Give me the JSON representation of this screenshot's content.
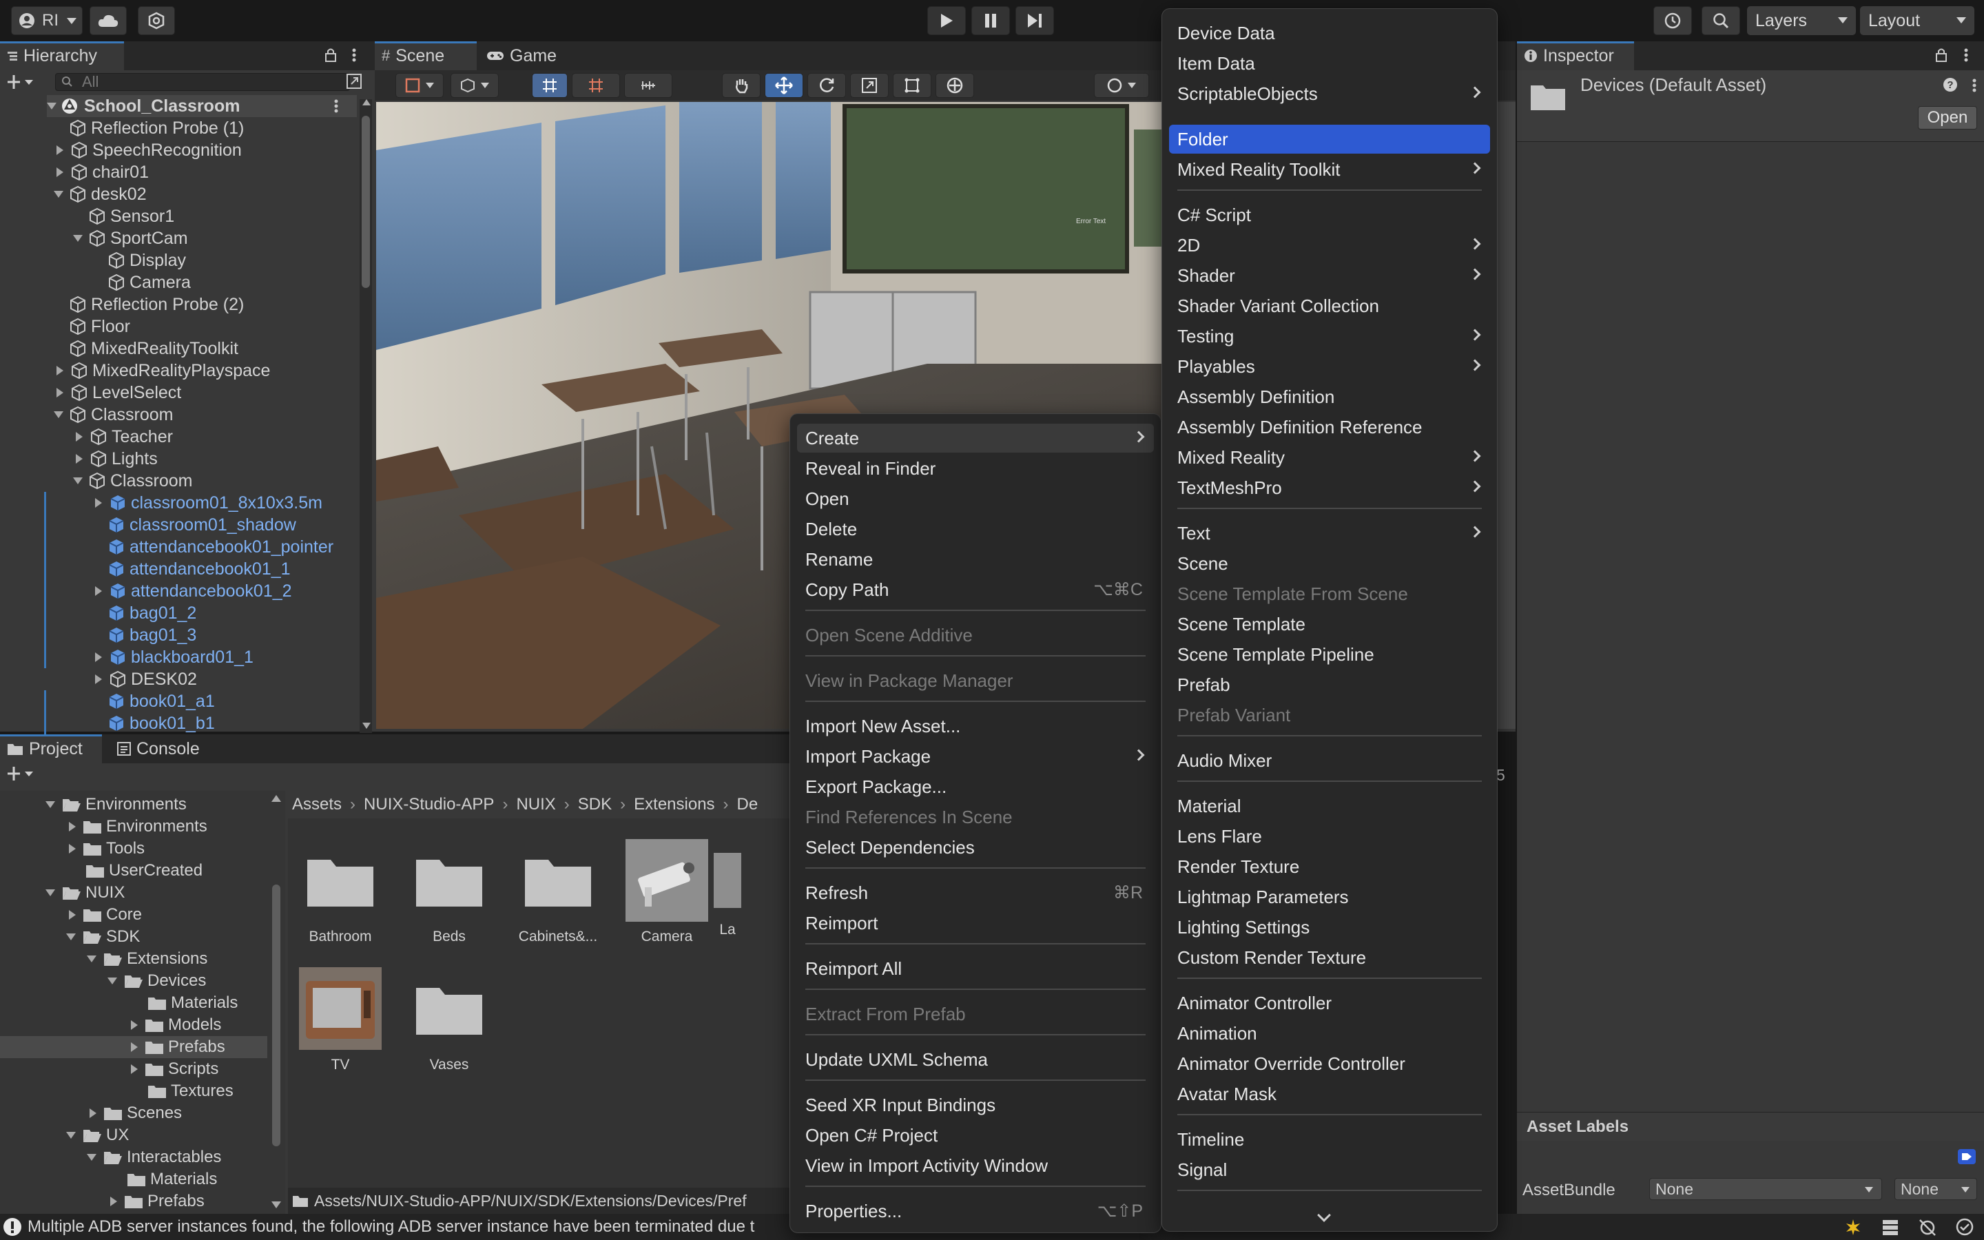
{
  "toolbar": {
    "account_label": "RI",
    "layers_label": "Layers",
    "layout_label": "Layout"
  },
  "hierarchy": {
    "tab_label": "Hierarchy",
    "search_placeholder": "All",
    "root": "School_Classroom",
    "rows": [
      {
        "label": "Reflection Probe (1)"
      },
      {
        "label": "SpeechRecognition"
      },
      {
        "label": "chair01"
      },
      {
        "label": "desk02"
      },
      {
        "label": "Sensor1"
      },
      {
        "label": "SportCam"
      },
      {
        "label": "Display"
      },
      {
        "label": "Camera"
      },
      {
        "label": "Reflection Probe (2)"
      },
      {
        "label": "Floor"
      },
      {
        "label": "MixedRealityToolkit"
      },
      {
        "label": "MixedRealityPlayspace"
      },
      {
        "label": "LevelSelect"
      },
      {
        "label": "Classroom"
      },
      {
        "label": "Teacher"
      },
      {
        "label": "Lights"
      },
      {
        "label": "Classroom"
      },
      {
        "label": "classroom01_8x10x3.5m"
      },
      {
        "label": "classroom01_shadow"
      },
      {
        "label": "attendancebook01_pointer"
      },
      {
        "label": "attendancebook01_1"
      },
      {
        "label": "attendancebook01_2"
      },
      {
        "label": "bag01_2"
      },
      {
        "label": "bag01_3"
      },
      {
        "label": "blackboard01_1"
      },
      {
        "label": "DESK02"
      },
      {
        "label": "book01_a1"
      },
      {
        "label": "book01_b1"
      }
    ]
  },
  "scene": {
    "tab_scene": "Scene",
    "tab_game": "Game",
    "sign_text": "Error Text"
  },
  "project": {
    "tab_project": "Project",
    "tab_console": "Console",
    "count": "5",
    "tree": [
      {
        "label": "Environments"
      },
      {
        "label": "Environments"
      },
      {
        "label": "Tools"
      },
      {
        "label": "UserCreated"
      },
      {
        "label": "NUIX"
      },
      {
        "label": "Core"
      },
      {
        "label": "SDK"
      },
      {
        "label": "Extensions"
      },
      {
        "label": "Devices"
      },
      {
        "label": "Materials"
      },
      {
        "label": "Models"
      },
      {
        "label": "Prefabs"
      },
      {
        "label": "Scripts"
      },
      {
        "label": "Textures"
      },
      {
        "label": "Scenes"
      },
      {
        "label": "UX"
      },
      {
        "label": "Interactables"
      },
      {
        "label": "Materials"
      },
      {
        "label": "Prefabs"
      }
    ],
    "breadcrumb": [
      "Assets",
      "NUIX-Studio-APP",
      "NUIX",
      "SDK",
      "Extensions",
      "De"
    ],
    "assets": [
      {
        "label": "Bathroom"
      },
      {
        "label": "Beds"
      },
      {
        "label": "Cabinets&..."
      },
      {
        "label": "Camera"
      },
      {
        "label": "La"
      },
      {
        "label": "TV"
      },
      {
        "label": "Vases"
      }
    ],
    "path": "Assets/NUIX-Studio-APP/NUIX/SDK/Extensions/Devices/Pref"
  },
  "inspector": {
    "tab_label": "Inspector",
    "asset_title": "Devices (Default Asset)",
    "open_button": "Open",
    "asset_labels": "Asset Labels",
    "assetbundle_label": "AssetBundle",
    "assetbundle_value": "None",
    "variant_value": "None"
  },
  "context_menu": {
    "items": [
      {
        "label": "Create"
      },
      {
        "label": "Reveal in Finder"
      },
      {
        "label": "Open"
      },
      {
        "label": "Delete"
      },
      {
        "label": "Rename"
      },
      {
        "label": "Copy Path",
        "shortcut": "⌥⌘C"
      },
      {
        "label": "Open Scene Additive"
      },
      {
        "label": "View in Package Manager"
      },
      {
        "label": "Import New Asset..."
      },
      {
        "label": "Import Package"
      },
      {
        "label": "Export Package..."
      },
      {
        "label": "Find References In Scene"
      },
      {
        "label": "Select Dependencies"
      },
      {
        "label": "Refresh",
        "shortcut": "⌘R"
      },
      {
        "label": "Reimport"
      },
      {
        "label": "Reimport All"
      },
      {
        "label": "Extract From Prefab"
      },
      {
        "label": "Update UXML Schema"
      },
      {
        "label": "Seed XR Input Bindings"
      },
      {
        "label": "Open C# Project"
      },
      {
        "label": "View in Import Activity Window"
      },
      {
        "label": "Properties...",
        "shortcut": "⌥⇧P"
      }
    ]
  },
  "create_menu": {
    "items": [
      {
        "label": "Device Data"
      },
      {
        "label": "Item Data"
      },
      {
        "label": "ScriptableObjects"
      },
      {
        "label": "Folder"
      },
      {
        "label": "Mixed Reality Toolkit"
      },
      {
        "label": "C# Script"
      },
      {
        "label": "2D"
      },
      {
        "label": "Shader"
      },
      {
        "label": "Shader Variant Collection"
      },
      {
        "label": "Testing"
      },
      {
        "label": "Playables"
      },
      {
        "label": "Assembly Definition"
      },
      {
        "label": "Assembly Definition Reference"
      },
      {
        "label": "Mixed Reality"
      },
      {
        "label": "TextMeshPro"
      },
      {
        "label": "Text"
      },
      {
        "label": "Scene"
      },
      {
        "label": "Scene Template From Scene"
      },
      {
        "label": "Scene Template"
      },
      {
        "label": "Scene Template Pipeline"
      },
      {
        "label": "Prefab"
      },
      {
        "label": "Prefab Variant"
      },
      {
        "label": "Audio Mixer"
      },
      {
        "label": "Material"
      },
      {
        "label": "Lens Flare"
      },
      {
        "label": "Render Texture"
      },
      {
        "label": "Lightmap Parameters"
      },
      {
        "label": "Lighting Settings"
      },
      {
        "label": "Custom Render Texture"
      },
      {
        "label": "Animator Controller"
      },
      {
        "label": "Animation"
      },
      {
        "label": "Animator Override Controller"
      },
      {
        "label": "Avatar Mask"
      },
      {
        "label": "Timeline"
      },
      {
        "label": "Signal"
      }
    ]
  },
  "status": {
    "message": "Multiple ADB server instances found, the following ADB server instance have been terminated due t"
  }
}
